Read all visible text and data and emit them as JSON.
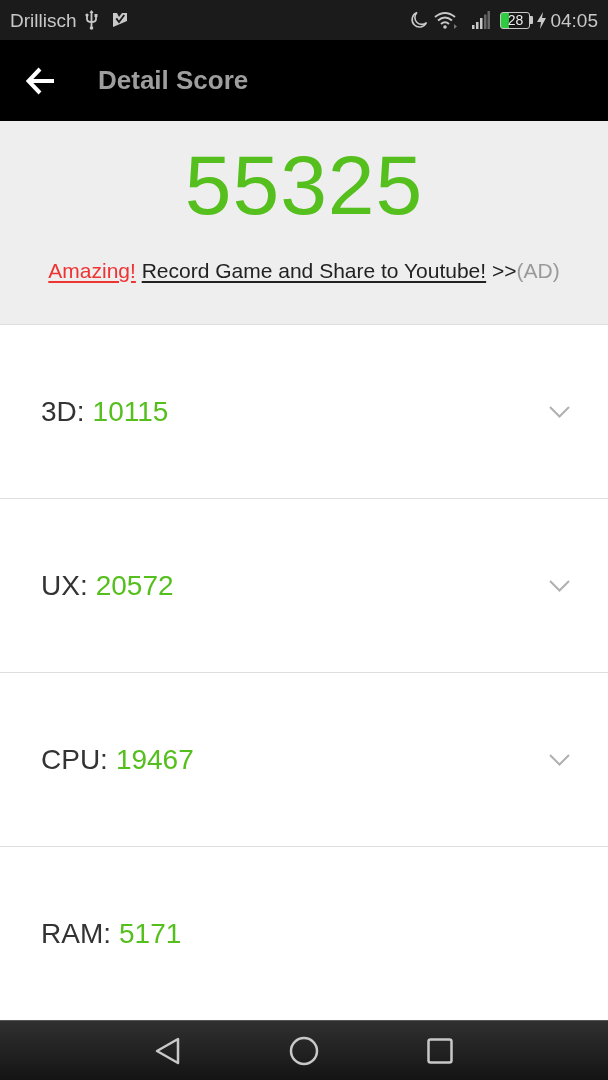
{
  "status_bar": {
    "carrier": "Drillisch",
    "battery": "28",
    "time": "04:05"
  },
  "app_bar": {
    "title": "Detail Score"
  },
  "total": {
    "score": "55325",
    "ad": {
      "highlight": "Amazing!",
      "text": "Record Game and Share to Youtube!",
      "arrows": ">>",
      "tag": "(AD)"
    }
  },
  "categories": [
    {
      "label": "3D:",
      "score": "10115",
      "kind": "expandable"
    },
    {
      "label": "UX:",
      "score": "20572",
      "kind": "expandable"
    },
    {
      "label": "CPU:",
      "score": "19467",
      "kind": "expandable"
    },
    {
      "label": "RAM:",
      "score": "5171",
      "kind": "plain"
    }
  ]
}
